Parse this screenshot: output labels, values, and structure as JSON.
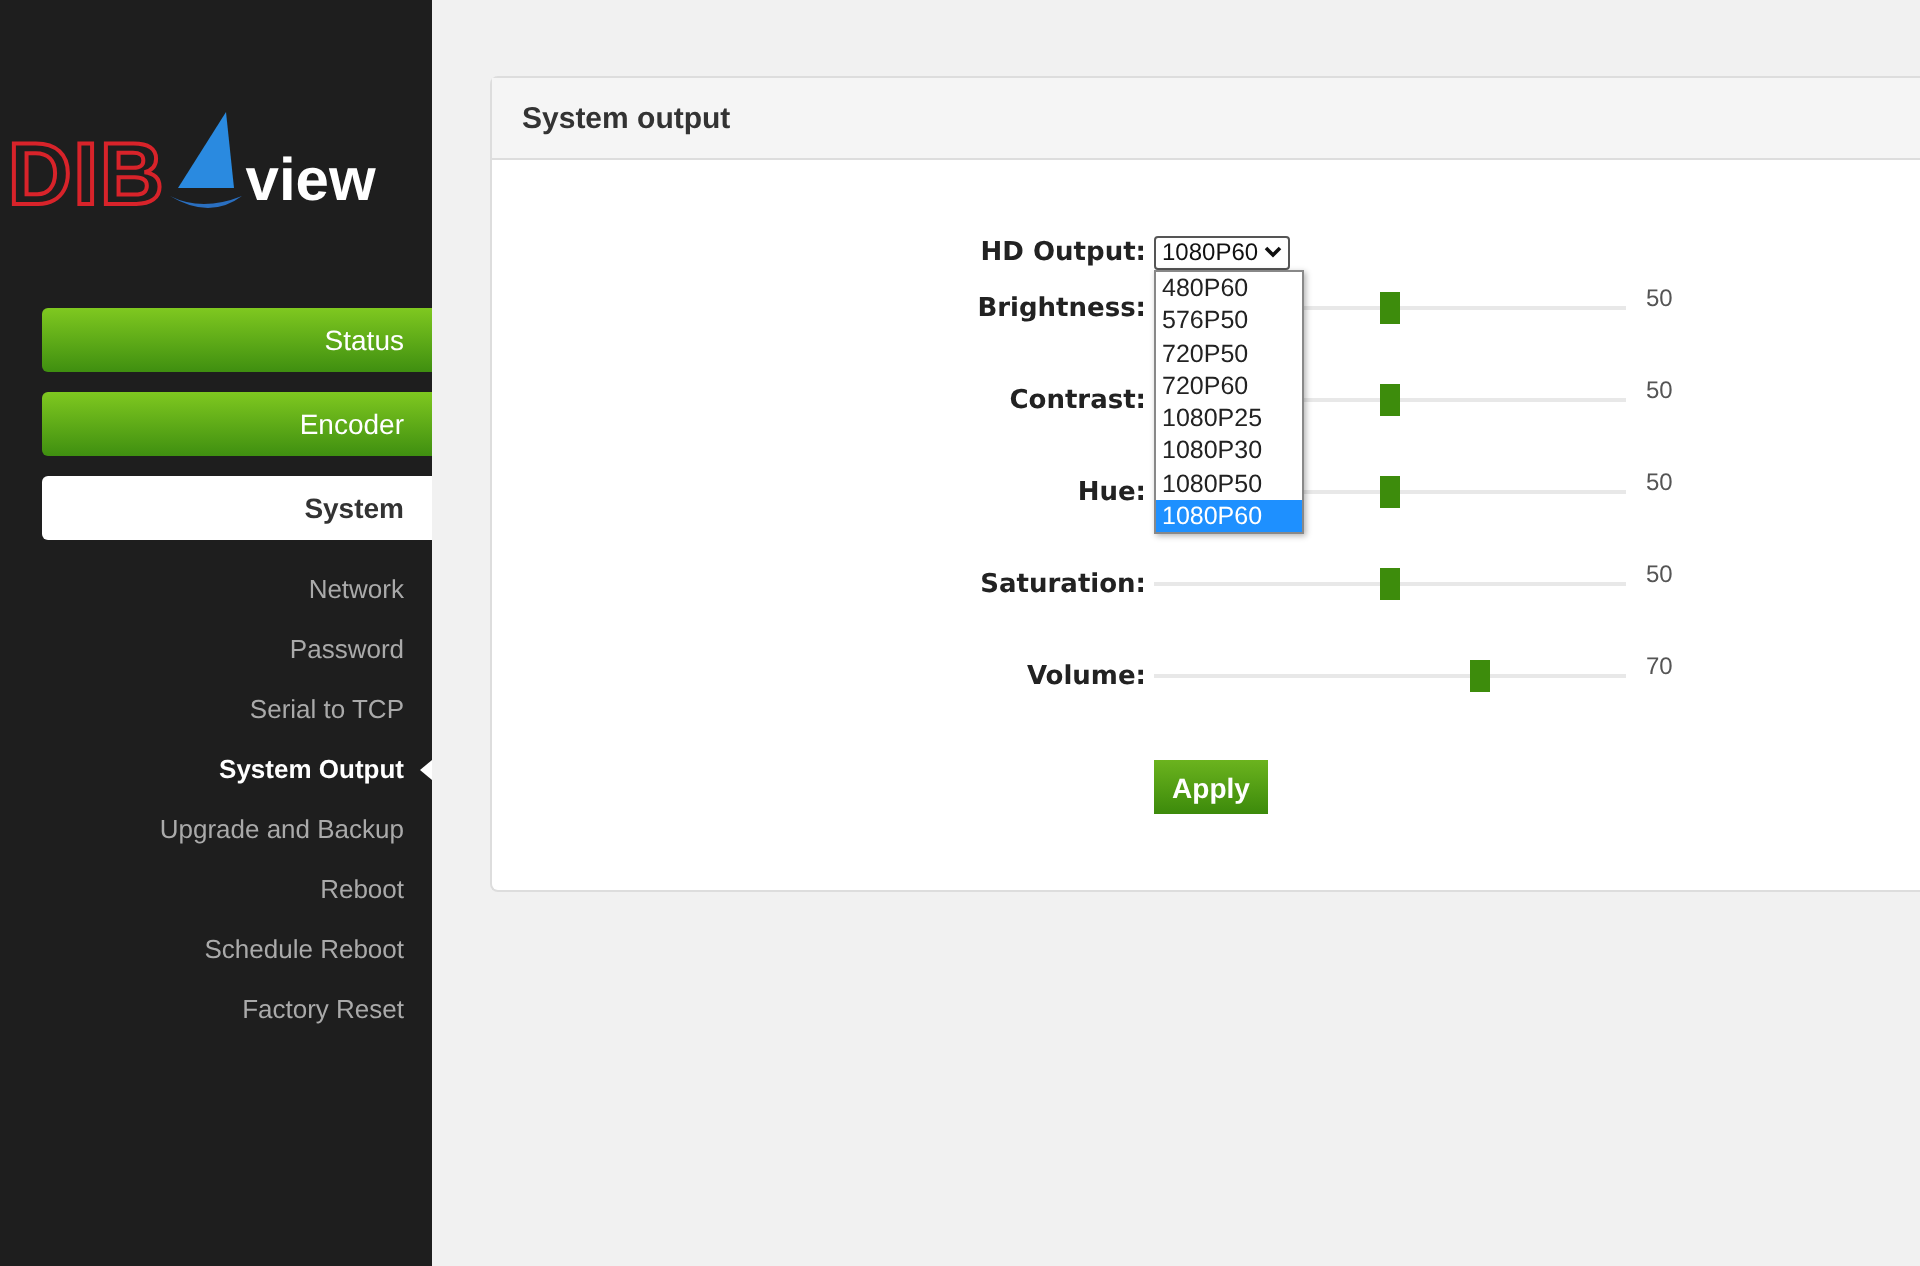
{
  "logo": {
    "brand": "DIB",
    "word": "view"
  },
  "nav": [
    {
      "label": "Status",
      "kind": "button",
      "selected": false
    },
    {
      "label": "Encoder",
      "kind": "button",
      "selected": false
    },
    {
      "label": "System",
      "kind": "button",
      "selected": true
    },
    {
      "label": "Network",
      "kind": "link",
      "selected": false
    },
    {
      "label": "Password",
      "kind": "link",
      "selected": false
    },
    {
      "label": "Serial to TCP",
      "kind": "link",
      "selected": false
    },
    {
      "label": "System Output",
      "kind": "link",
      "selected": true
    },
    {
      "label": "Upgrade and Backup",
      "kind": "link",
      "selected": false
    },
    {
      "label": "Reboot",
      "kind": "link",
      "selected": false
    },
    {
      "label": "Schedule Reboot",
      "kind": "link",
      "selected": false
    },
    {
      "label": "Factory Reset",
      "kind": "link",
      "selected": false
    }
  ],
  "panel": {
    "title": "System output",
    "hd_output": {
      "label": "HD Output:",
      "value": "1080P60",
      "expanded": true,
      "options": [
        {
          "label": "480P60",
          "selected": false
        },
        {
          "label": "576P50",
          "selected": false
        },
        {
          "label": "720P50",
          "selected": false
        },
        {
          "label": "720P60",
          "selected": false
        },
        {
          "label": "1080P25",
          "selected": false
        },
        {
          "label": "1080P30",
          "selected": false
        },
        {
          "label": "1080P50",
          "selected": false
        },
        {
          "label": "1080P60",
          "selected": true
        }
      ]
    },
    "sliders": [
      {
        "label": "Brightness:",
        "level": 0.5,
        "reading": "50"
      },
      {
        "label": "Contrast:",
        "level": 0.5,
        "reading": "50"
      },
      {
        "label": "Hue:",
        "level": 0.5,
        "reading": "50"
      },
      {
        "label": "Saturation:",
        "level": 0.5,
        "reading": "50"
      },
      {
        "label": "Volume:",
        "level": 0.7,
        "reading": "70"
      }
    ],
    "apply": "Apply"
  }
}
